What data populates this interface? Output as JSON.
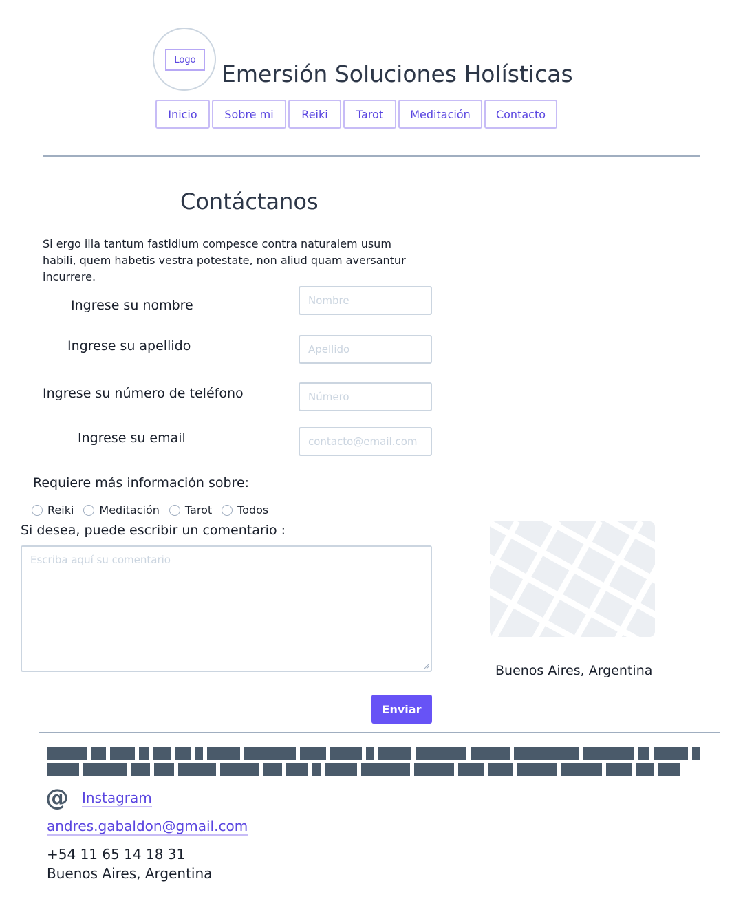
{
  "header": {
    "logo_label": "Logo",
    "site_title": "Emersión Soluciones Holísticas",
    "nav": [
      "Inicio",
      "Sobre mi",
      "Reiki",
      "Tarot",
      "Meditación",
      "Contacto"
    ]
  },
  "contact": {
    "title": "Contáctanos",
    "intro": "Si ergo illa tantum fastidium compesce contra naturalem usum habili, quem habetis vestra potestate, non aliud quam aversantur incurrere.",
    "fields": {
      "name": {
        "label": "Ingrese su nombre",
        "placeholder": "Nombre"
      },
      "lastname": {
        "label": "Ingrese su apellido",
        "placeholder": "Apellido"
      },
      "phone": {
        "label": "Ingrese su número de teléfono",
        "placeholder": "Número"
      },
      "email": {
        "label": "Ingrese su email",
        "placeholder": "contacto@email.com"
      }
    },
    "interest_label": "Requiere más información sobre:",
    "interest_options": [
      "Reiki",
      "Meditación",
      "Tarot",
      "Todos"
    ],
    "comment_label": "Si desea, puede escribir un comentario :",
    "comment_placeholder": "Escriba aquí su comentario",
    "submit_label": "Enviar"
  },
  "map": {
    "caption": "Buenos Aires, Argentina",
    "icon": "map-icon"
  },
  "footer": {
    "instagram_icon": "at-icon",
    "instagram_label": "Instagram",
    "email": "andres.gabaldon@gmail.com",
    "phone": "+54 11 65 14 18 31",
    "location": "Buenos Aires, Argentina"
  },
  "colors": {
    "accent": "#6753f6",
    "link": "#5a46e0",
    "border": "#cbd5e0",
    "redacted": "#4a5a6a"
  }
}
